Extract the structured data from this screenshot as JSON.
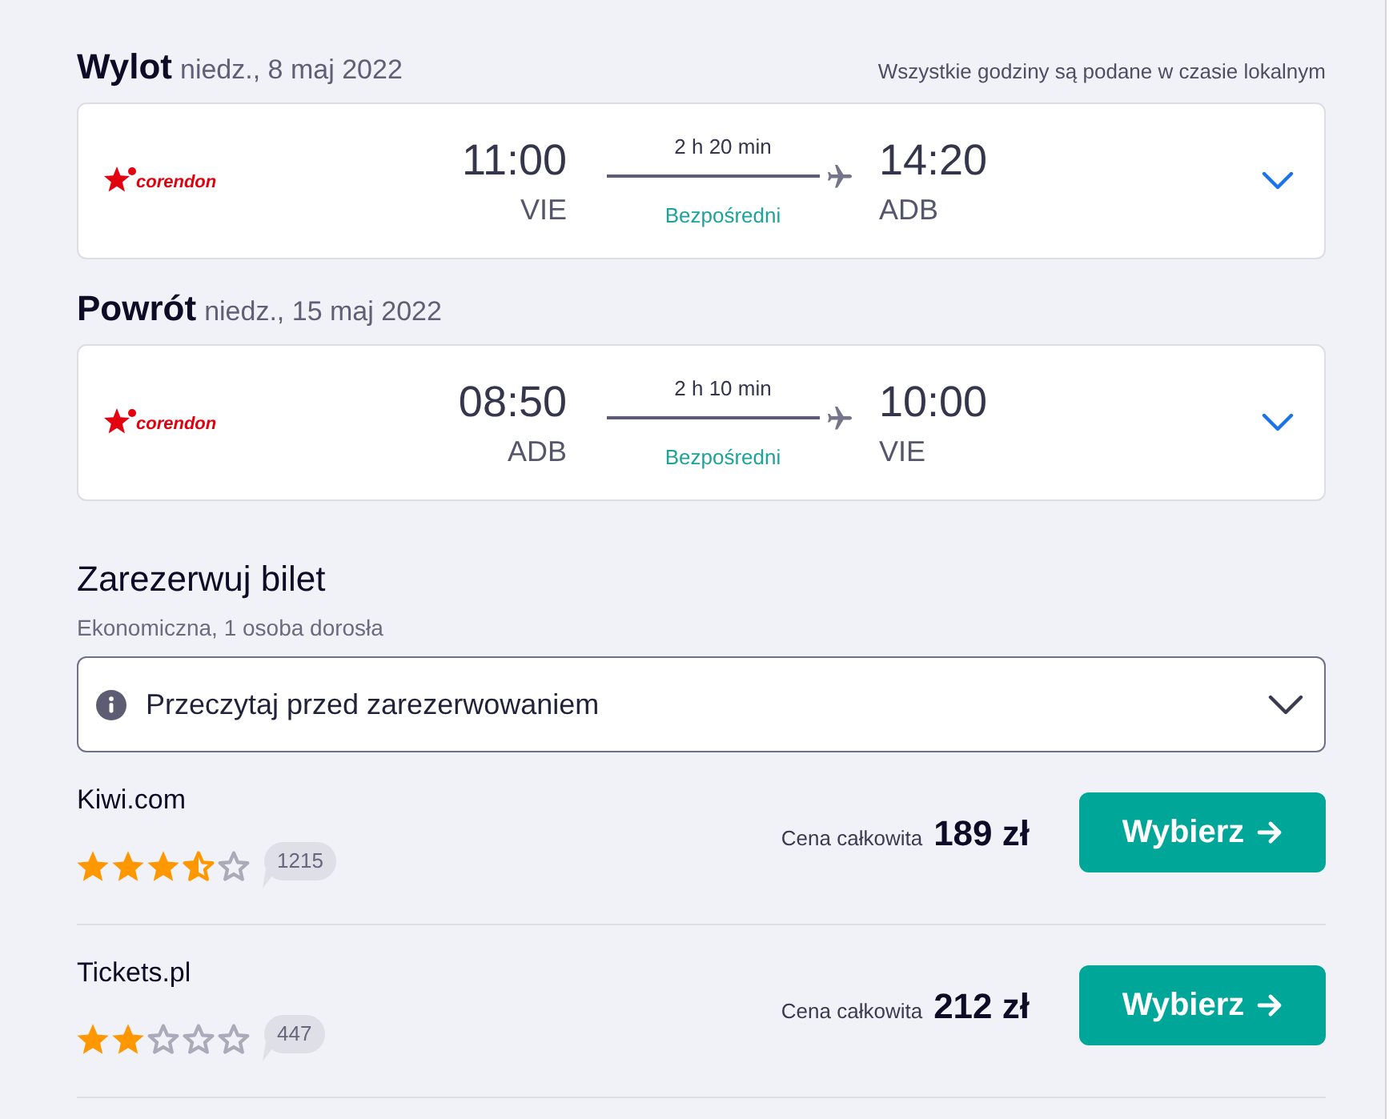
{
  "legs": [
    {
      "direction": "Wylot",
      "date": "niedz., 8 maj 2022",
      "note": "Wszystkie godziny są podane w czasie lokalnym",
      "airline_logo": "corendon",
      "departure_time": "11:00",
      "departure_airport": "VIE",
      "duration": "2 h 20 min",
      "stops": "Bezpośredni",
      "arrival_time": "14:20",
      "arrival_airport": "ADB",
      "expanded": false
    },
    {
      "direction": "Powrót",
      "date": "niedz., 15 maj 2022",
      "airline_logo": "corendon",
      "departure_time": "08:50",
      "departure_airport": "ADB",
      "duration": "2 h 10 min",
      "stops": "Bezpośredni",
      "arrival_time": "10:00",
      "arrival_airport": "VIE",
      "expanded": false
    }
  ],
  "booking": {
    "title": "Zarezerwuj bilet",
    "subtitle": "Ekonomiczna, 1 osoba dorosła",
    "notice": {
      "label": "Przeczytaj przed zarezerwowaniem",
      "expanded": false
    },
    "offers": [
      {
        "provider": "Kiwi.com",
        "stars": 3.5,
        "reviews": "1215",
        "price_label": "Cena całkowita",
        "price": "189 zł",
        "button": "Wybierz"
      },
      {
        "provider": "Tickets.pl",
        "stars": 2,
        "reviews": "447",
        "price_label": "Cena całkowita",
        "price": "212 zł",
        "button": "Wybierz"
      }
    ]
  }
}
